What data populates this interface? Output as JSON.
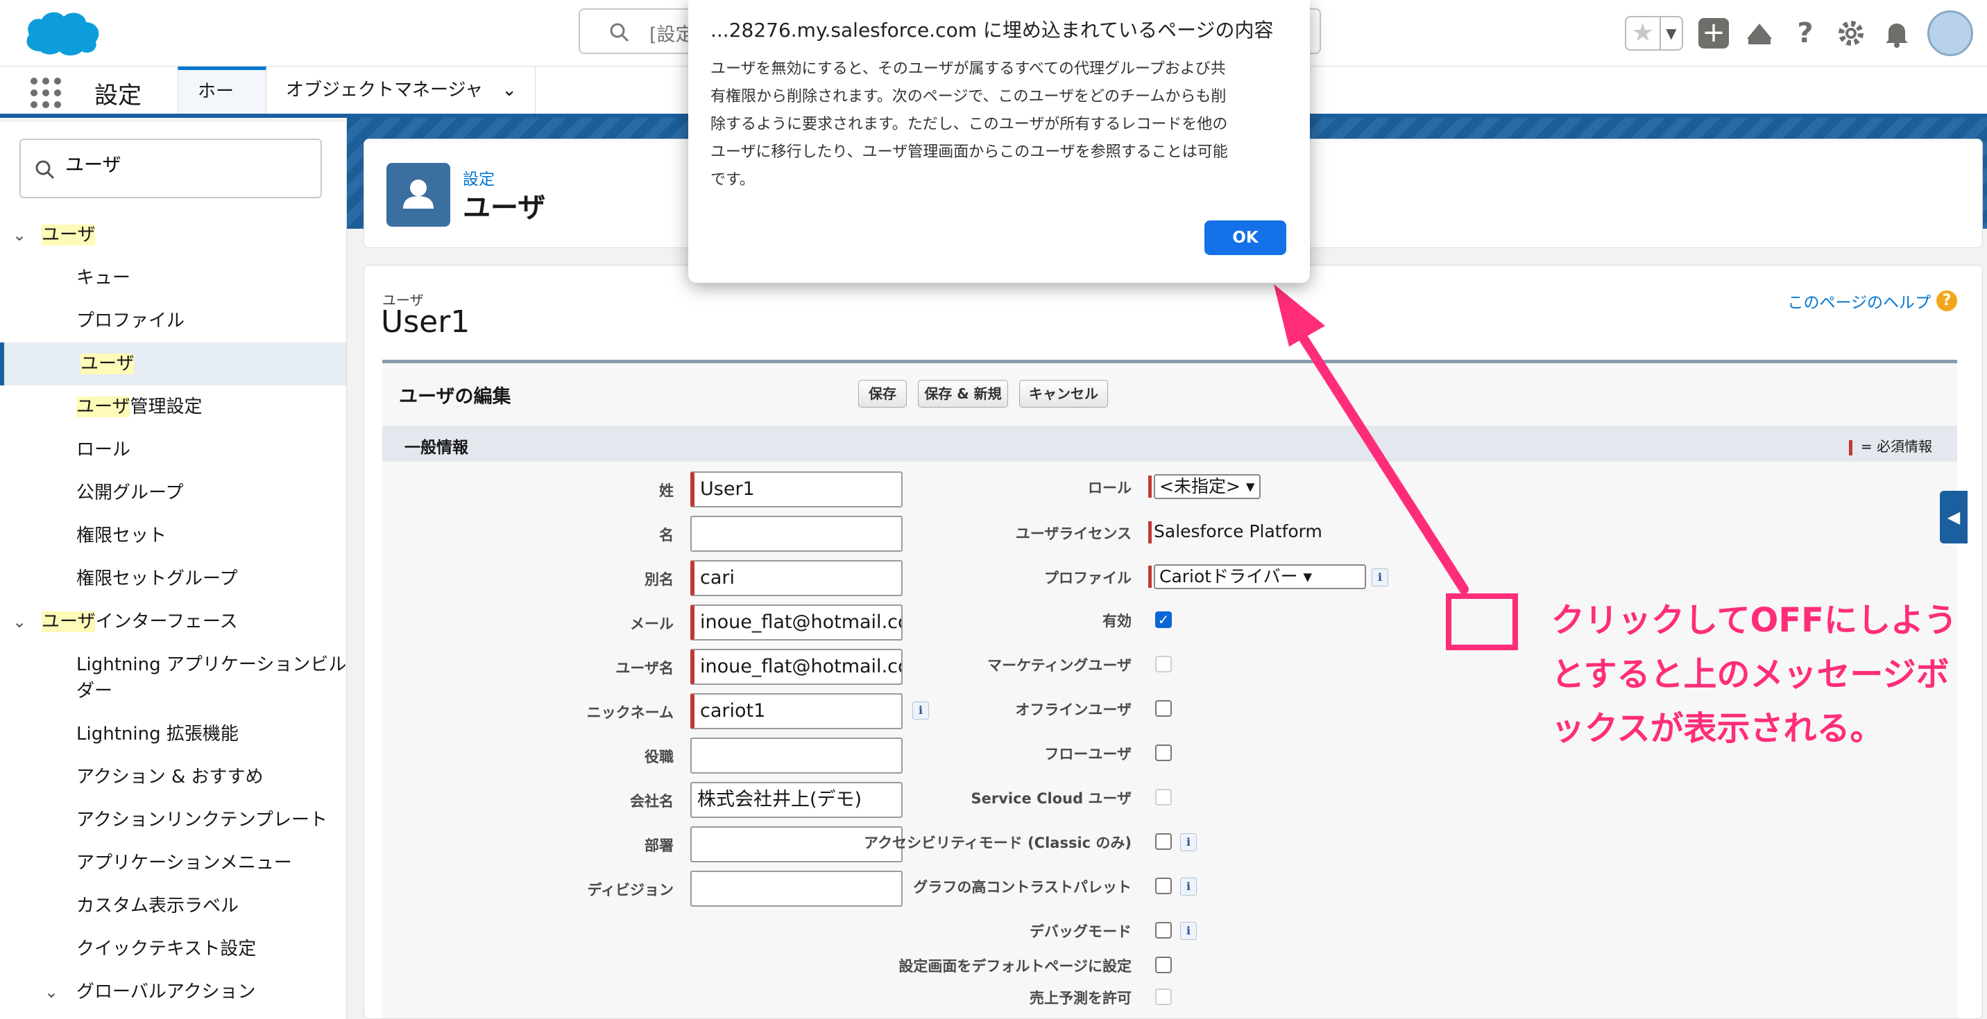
{
  "header": {
    "search_placeholder": "[設定"
  },
  "nav": {
    "app_name": "設定",
    "tabs": [
      "ホーム",
      "オブジェクトマネージャ"
    ]
  },
  "sidebar": {
    "quickfind_value": "ユーザ",
    "items": [
      {
        "pre": "",
        "hl": "ユーザ",
        "post": ""
      },
      {
        "pre": "",
        "hl": "",
        "post": "キュー"
      },
      {
        "pre": "",
        "hl": "",
        "post": "プロファイル"
      },
      {
        "pre": "",
        "hl": "ユーザ",
        "post": ""
      },
      {
        "pre": "",
        "hl": "ユーザ",
        "post": "管理設定"
      },
      {
        "pre": "",
        "hl": "",
        "post": "ロール"
      },
      {
        "pre": "",
        "hl": "",
        "post": "公開グループ"
      },
      {
        "pre": "",
        "hl": "",
        "post": "権限セット"
      },
      {
        "pre": "",
        "hl": "",
        "post": "権限セットグループ"
      },
      {
        "pre": "",
        "hl": "ユーザ",
        "post": "インターフェース"
      },
      {
        "pre": "",
        "hl": "",
        "post": "Lightning アプリケーションビル"
      },
      {
        "pre": "",
        "hl": "",
        "post": "ダー"
      },
      {
        "pre": "",
        "hl": "",
        "post": "Lightning 拡張機能"
      },
      {
        "pre": "",
        "hl": "",
        "post": "アクション & おすすめ"
      },
      {
        "pre": "",
        "hl": "",
        "post": "アクションリンクテンプレート"
      },
      {
        "pre": "",
        "hl": "",
        "post": "アプリケーションメニュー"
      },
      {
        "pre": "",
        "hl": "",
        "post": "カスタム表示ラベル"
      },
      {
        "pre": "",
        "hl": "",
        "post": "クイックテキスト設定"
      },
      {
        "pre": "",
        "hl": "",
        "post": "グローバルアクション"
      }
    ]
  },
  "page_header": {
    "breadcrumb": "設定",
    "title": "ユーザ"
  },
  "record": {
    "object_label": "ユーザ",
    "name": "User1",
    "help_link": "このページのヘルプ"
  },
  "edit": {
    "title": "ユーザの編集",
    "save": "保存",
    "save_new": "保存 & 新規",
    "cancel": "キャンセル",
    "section_title": "一般情報",
    "required_note": "= 必須情報"
  },
  "left_fields": [
    {
      "label": "姓",
      "value": "User1"
    },
    {
      "label": "名",
      "value": ""
    },
    {
      "label": "別名",
      "value": "cari"
    },
    {
      "label": "メール",
      "value": "inoue_flat@hotmail.com"
    },
    {
      "label": "ユーザ名",
      "value": "inoue_flat@hotmail.com"
    },
    {
      "label": "ニックネーム",
      "value": "cariot1"
    },
    {
      "label": "役職",
      "value": ""
    },
    {
      "label": "会社名",
      "value": "株式会社井上(デモ)"
    },
    {
      "label": "部署",
      "value": ""
    },
    {
      "label": "ディビジョン",
      "value": ""
    }
  ],
  "right_fields": {
    "role_label": "ロール",
    "role_value": "<未指定>",
    "license_label": "ユーザライセンス",
    "license_value": "Salesforce Platform",
    "profile_label": "プロファイル",
    "profile_value": "Cariotドライバー",
    "checkboxes": [
      {
        "label": "有効",
        "checked": true
      },
      {
        "label": "マーケティングユーザ",
        "checked": false
      },
      {
        "label": "オフラインユーザ",
        "checked": false
      },
      {
        "label": "フローユーザ",
        "checked": false
      },
      {
        "label": "Service Cloud ユーザ",
        "checked": false
      },
      {
        "label": "アクセシビリティモード (Classic のみ)",
        "checked": false
      },
      {
        "label": "グラフの高コントラストパレット",
        "checked": false
      },
      {
        "label": "デバッグモード",
        "checked": false
      },
      {
        "label": "設定画面をデフォルトページに設定",
        "checked": false
      },
      {
        "label": "売上予測を許可",
        "checked": false
      }
    ]
  },
  "dialog": {
    "title": "...28276.my.salesforce.com に埋め込まれているページの内容",
    "lines": [
      "ユーザを無効にすると、そのユーザが属するすべての代理グループおよび共",
      "有権限から削除されます。次のページで、このユーザをどのチームからも削",
      "除するように要求されます。ただし、このユーザが所有するレコードを他の",
      "ユーザに移行したり、ユーザ管理画面からこのユーザを参照することは可能",
      "です。"
    ],
    "ok": "OK"
  },
  "annotation": {
    "lines": [
      "クリックしてOFFにしよう",
      "とすると上のメッセージボ",
      "ックスが表示される。"
    ],
    "color": "#ff2d79"
  }
}
